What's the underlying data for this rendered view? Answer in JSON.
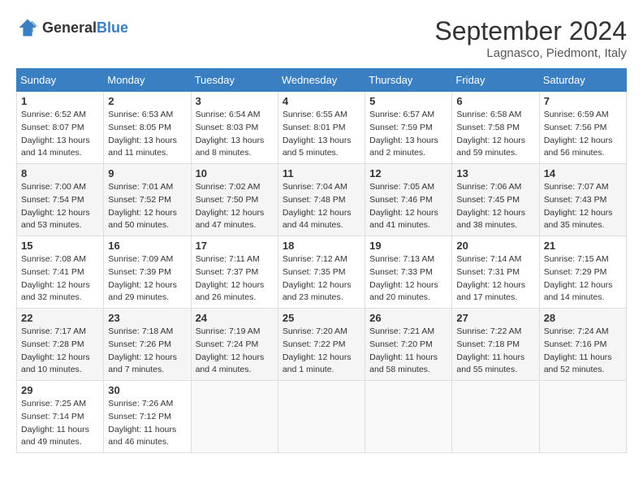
{
  "header": {
    "logo": {
      "text_general": "General",
      "text_blue": "Blue"
    },
    "month_year": "September 2024",
    "location": "Lagnasco, Piedmont, Italy"
  },
  "calendar": {
    "days_of_week": [
      "Sunday",
      "Monday",
      "Tuesday",
      "Wednesday",
      "Thursday",
      "Friday",
      "Saturday"
    ],
    "weeks": [
      [
        {
          "day": "1",
          "sunrise": "6:52 AM",
          "sunset": "8:07 PM",
          "daylight": "13 hours and 14 minutes."
        },
        {
          "day": "2",
          "sunrise": "6:53 AM",
          "sunset": "8:05 PM",
          "daylight": "13 hours and 11 minutes."
        },
        {
          "day": "3",
          "sunrise": "6:54 AM",
          "sunset": "8:03 PM",
          "daylight": "13 hours and 8 minutes."
        },
        {
          "day": "4",
          "sunrise": "6:55 AM",
          "sunset": "8:01 PM",
          "daylight": "13 hours and 5 minutes."
        },
        {
          "day": "5",
          "sunrise": "6:57 AM",
          "sunset": "7:59 PM",
          "daylight": "13 hours and 2 minutes."
        },
        {
          "day": "6",
          "sunrise": "6:58 AM",
          "sunset": "7:58 PM",
          "daylight": "12 hours and 59 minutes."
        },
        {
          "day": "7",
          "sunrise": "6:59 AM",
          "sunset": "7:56 PM",
          "daylight": "12 hours and 56 minutes."
        }
      ],
      [
        {
          "day": "8",
          "sunrise": "7:00 AM",
          "sunset": "7:54 PM",
          "daylight": "12 hours and 53 minutes."
        },
        {
          "day": "9",
          "sunrise": "7:01 AM",
          "sunset": "7:52 PM",
          "daylight": "12 hours and 50 minutes."
        },
        {
          "day": "10",
          "sunrise": "7:02 AM",
          "sunset": "7:50 PM",
          "daylight": "12 hours and 47 minutes."
        },
        {
          "day": "11",
          "sunrise": "7:04 AM",
          "sunset": "7:48 PM",
          "daylight": "12 hours and 44 minutes."
        },
        {
          "day": "12",
          "sunrise": "7:05 AM",
          "sunset": "7:46 PM",
          "daylight": "12 hours and 41 minutes."
        },
        {
          "day": "13",
          "sunrise": "7:06 AM",
          "sunset": "7:45 PM",
          "daylight": "12 hours and 38 minutes."
        },
        {
          "day": "14",
          "sunrise": "7:07 AM",
          "sunset": "7:43 PM",
          "daylight": "12 hours and 35 minutes."
        }
      ],
      [
        {
          "day": "15",
          "sunrise": "7:08 AM",
          "sunset": "7:41 PM",
          "daylight": "12 hours and 32 minutes."
        },
        {
          "day": "16",
          "sunrise": "7:09 AM",
          "sunset": "7:39 PM",
          "daylight": "12 hours and 29 minutes."
        },
        {
          "day": "17",
          "sunrise": "7:11 AM",
          "sunset": "7:37 PM",
          "daylight": "12 hours and 26 minutes."
        },
        {
          "day": "18",
          "sunrise": "7:12 AM",
          "sunset": "7:35 PM",
          "daylight": "12 hours and 23 minutes."
        },
        {
          "day": "19",
          "sunrise": "7:13 AM",
          "sunset": "7:33 PM",
          "daylight": "12 hours and 20 minutes."
        },
        {
          "day": "20",
          "sunrise": "7:14 AM",
          "sunset": "7:31 PM",
          "daylight": "12 hours and 17 minutes."
        },
        {
          "day": "21",
          "sunrise": "7:15 AM",
          "sunset": "7:29 PM",
          "daylight": "12 hours and 14 minutes."
        }
      ],
      [
        {
          "day": "22",
          "sunrise": "7:17 AM",
          "sunset": "7:28 PM",
          "daylight": "12 hours and 10 minutes."
        },
        {
          "day": "23",
          "sunrise": "7:18 AM",
          "sunset": "7:26 PM",
          "daylight": "12 hours and 7 minutes."
        },
        {
          "day": "24",
          "sunrise": "7:19 AM",
          "sunset": "7:24 PM",
          "daylight": "12 hours and 4 minutes."
        },
        {
          "day": "25",
          "sunrise": "7:20 AM",
          "sunset": "7:22 PM",
          "daylight": "12 hours and 1 minute."
        },
        {
          "day": "26",
          "sunrise": "7:21 AM",
          "sunset": "7:20 PM",
          "daylight": "11 hours and 58 minutes."
        },
        {
          "day": "27",
          "sunrise": "7:22 AM",
          "sunset": "7:18 PM",
          "daylight": "11 hours and 55 minutes."
        },
        {
          "day": "28",
          "sunrise": "7:24 AM",
          "sunset": "7:16 PM",
          "daylight": "11 hours and 52 minutes."
        }
      ],
      [
        {
          "day": "29",
          "sunrise": "7:25 AM",
          "sunset": "7:14 PM",
          "daylight": "11 hours and 49 minutes."
        },
        {
          "day": "30",
          "sunrise": "7:26 AM",
          "sunset": "7:12 PM",
          "daylight": "11 hours and 46 minutes."
        },
        null,
        null,
        null,
        null,
        null
      ]
    ]
  }
}
